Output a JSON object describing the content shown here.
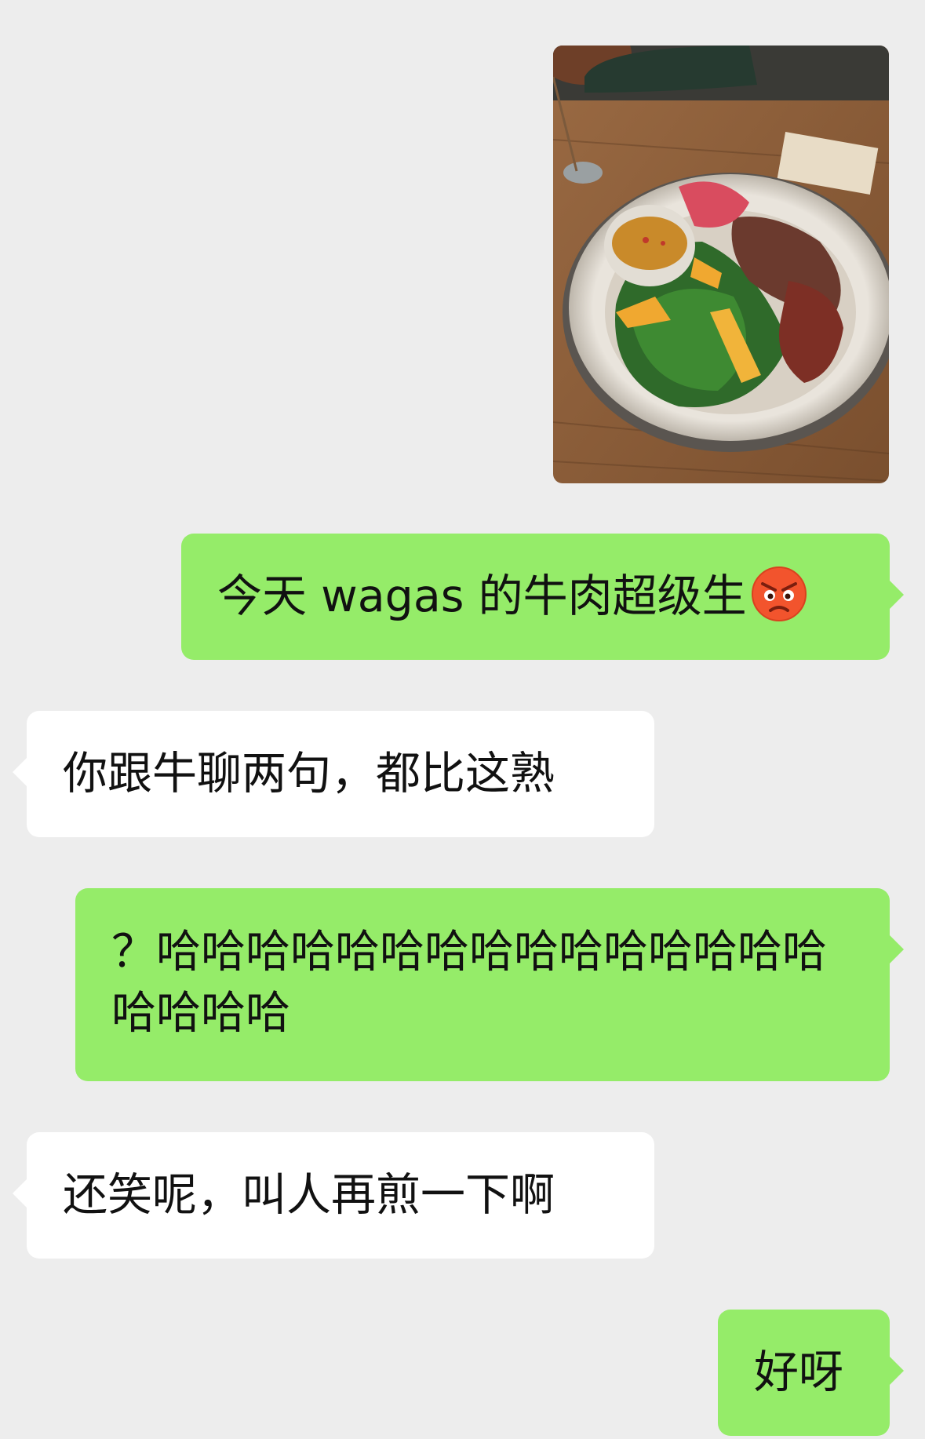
{
  "chat": {
    "photo": {
      "description_icon": "food-photo",
      "alt": "salad bowl with beef"
    },
    "messages": [
      {
        "id": "m1",
        "side": "me",
        "text": "今天 wagas 的牛肉超级生",
        "emoji": "angry-face-emoji"
      },
      {
        "id": "m2",
        "side": "them",
        "text": "你跟牛聊两句，都比这熟"
      },
      {
        "id": "m3",
        "side": "me",
        "text": "？哈哈哈哈哈哈哈哈哈哈哈哈哈哈哈哈哈哈哈"
      },
      {
        "id": "m4",
        "side": "them",
        "text": "还笑呢，叫人再煎一下啊"
      },
      {
        "id": "m5",
        "side": "me",
        "text": "好呀"
      }
    ]
  },
  "colors": {
    "background": "#ededed",
    "me_bubble": "#95ec69",
    "them_bubble": "#ffffff"
  }
}
